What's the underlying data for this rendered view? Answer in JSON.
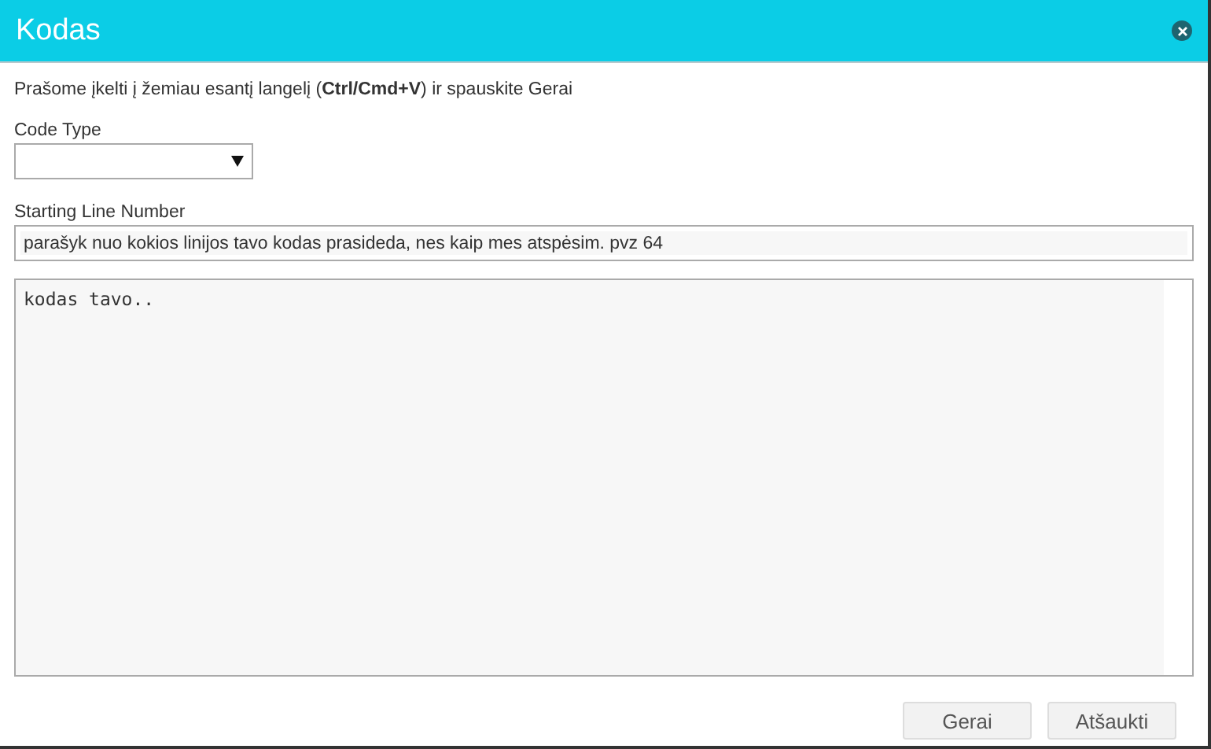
{
  "window": {
    "title": "Kodas"
  },
  "instructions": "Prašome įkelti į žemiau esantį langelį (**Ctrl/Cmd+V**) ir spauskite Gerai",
  "code_type": {
    "label": "Code Type"
  },
  "starting_line": {
    "label": "Starting Line Number",
    "placeholder": "parašyk nuo kokios linijos tavo kodas prasideda, nes kaip mes atspėsim. pvz 64"
  },
  "code": {
    "placeholder": "kodas tavo.."
  },
  "buttons": [
    "Gerai",
    "Atšaukti"
  ]
}
